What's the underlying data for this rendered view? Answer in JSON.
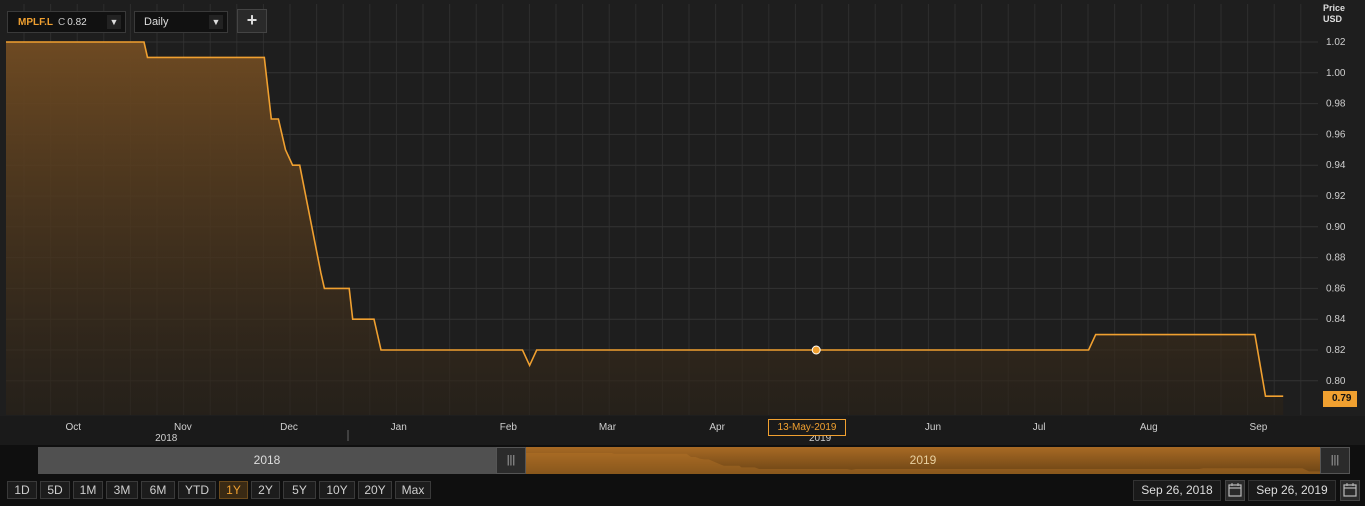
{
  "toolbar": {
    "ticker": "MPLF.L",
    "close_prefix": "C",
    "close_value": "0.82",
    "interval": "Daily",
    "add_label": "+"
  },
  "axis": {
    "price_label": "Price",
    "currency_label": "USD",
    "last_value": "0.79",
    "crosshair_date": "13-May-2019"
  },
  "colors": {
    "accent": "#f0a030",
    "background": "#1e1e1e",
    "grid": "#333333"
  },
  "navigator": {
    "left_year": "2018",
    "right_year": "2019",
    "handle_glyph": "|||"
  },
  "range_buttons": [
    "1D",
    "5D",
    "1M",
    "3M",
    "6M",
    "YTD",
    "1Y",
    "2Y",
    "5Y",
    "10Y",
    "20Y",
    "Max"
  ],
  "active_range": "1Y",
  "date_range": {
    "from": "Sep 26, 2018",
    "to": "Sep 26, 2019"
  },
  "chart_data": {
    "type": "area",
    "title": "",
    "ylabel": "Price USD",
    "ylim": [
      0.79,
      1.03
    ],
    "yticks": [
      "1.02",
      "1.00",
      "0.98",
      "0.96",
      "0.94",
      "0.92",
      "0.90",
      "0.88",
      "0.86",
      "0.84",
      "0.82",
      "0.80"
    ],
    "xticks": [
      {
        "label": "Oct",
        "date": "2018-10-15",
        "year": "2018"
      },
      {
        "label": "Nov",
        "date": "2018-11-15"
      },
      {
        "label": "Dec",
        "date": "2018-12-15"
      },
      {
        "label": "Jan",
        "date": "2019-01-15"
      },
      {
        "label": "Feb",
        "date": "2019-02-15"
      },
      {
        "label": "Mar",
        "date": "2019-03-15"
      },
      {
        "label": "Apr",
        "date": "2019-04-15",
        "year": "2019"
      },
      {
        "label": "May",
        "date": "2019-05-15"
      },
      {
        "label": "Jun",
        "date": "2019-06-15"
      },
      {
        "label": "Jul",
        "date": "2019-07-15"
      },
      {
        "label": "Aug",
        "date": "2019-08-15"
      },
      {
        "label": "Sep",
        "date": "2019-09-15"
      }
    ],
    "series": [
      {
        "values": [
          [
            "2018-09-26",
            1.02
          ],
          [
            "2018-11-04",
            1.02
          ],
          [
            "2018-11-05",
            1.01
          ],
          [
            "2018-12-08",
            1.01
          ],
          [
            "2018-12-10",
            0.97
          ],
          [
            "2018-12-12",
            0.97
          ],
          [
            "2018-12-14",
            0.95
          ],
          [
            "2018-12-16",
            0.94
          ],
          [
            "2018-12-18",
            0.94
          ],
          [
            "2018-12-24",
            0.87
          ],
          [
            "2018-12-25",
            0.86
          ],
          [
            "2019-01-01",
            0.86
          ],
          [
            "2019-01-02",
            0.84
          ],
          [
            "2019-01-08",
            0.84
          ],
          [
            "2019-01-10",
            0.82
          ],
          [
            "2019-02-19",
            0.82
          ],
          [
            "2019-02-21",
            0.81
          ],
          [
            "2019-02-23",
            0.82
          ],
          [
            "2019-07-29",
            0.82
          ],
          [
            "2019-07-31",
            0.83
          ],
          [
            "2019-09-14",
            0.83
          ],
          [
            "2019-09-17",
            0.79
          ],
          [
            "2019-09-22",
            0.79
          ]
        ]
      }
    ],
    "highlight_point": {
      "date": "2019-05-13",
      "value": 0.82
    },
    "grid": true
  }
}
